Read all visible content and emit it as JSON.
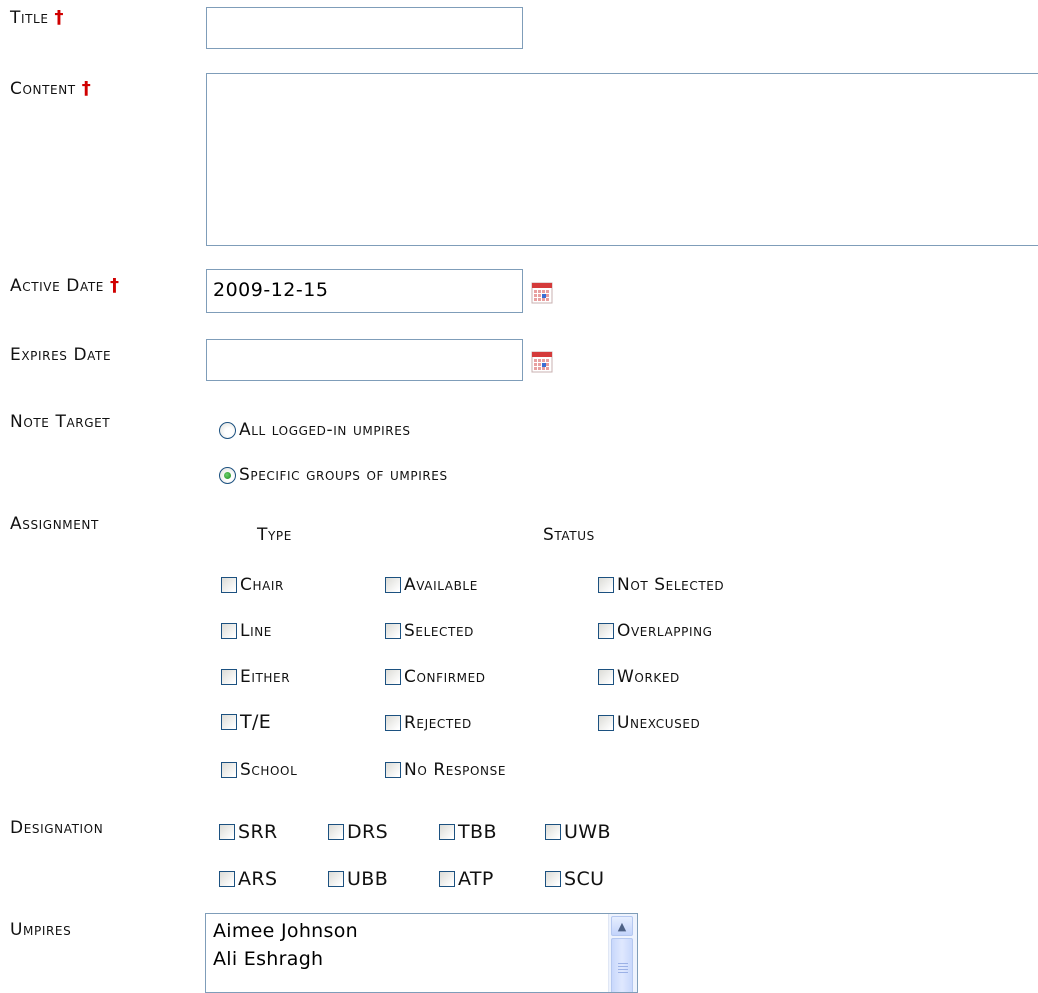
{
  "form": {
    "title": {
      "label": "Title",
      "required_mark": "†",
      "value": ""
    },
    "content": {
      "label": "Content",
      "required_mark": "†",
      "value": ""
    },
    "active_date": {
      "label": "Active Date",
      "required_mark": "†",
      "value": "2009-12-15",
      "calendar_icon": "calendar-icon"
    },
    "expires_date": {
      "label": "Expires Date",
      "value": "",
      "calendar_icon": "calendar-icon"
    },
    "note_target": {
      "label": "Note Target",
      "options": [
        {
          "label": "All logged-in umpires",
          "selected": false
        },
        {
          "label": "Specific groups of umpires",
          "selected": true
        }
      ]
    },
    "assignment": {
      "label": "Assignment",
      "type_header": "Type",
      "status_header": "Status",
      "type_options": [
        "Chair",
        "Line",
        "Either",
        "T/E",
        "School"
      ],
      "status_col1": [
        "Available",
        "Selected",
        "Confirmed",
        "Rejected",
        "No Response"
      ],
      "status_col2": [
        "Not Selected",
        "Overlapping",
        "Worked",
        "Unexcused"
      ]
    },
    "designation": {
      "label": "Designation",
      "row1": [
        "SRR",
        "DRS",
        "TBB",
        "UWB"
      ],
      "row2": [
        "ARS",
        "UBB",
        "ATP",
        "SCU"
      ]
    },
    "umpires": {
      "label": "Umpires",
      "items": [
        "Aimee Johnson",
        "Ali Eshragh"
      ]
    }
  },
  "colors": {
    "required": "#d00000",
    "input_border": "#7f9db9"
  }
}
